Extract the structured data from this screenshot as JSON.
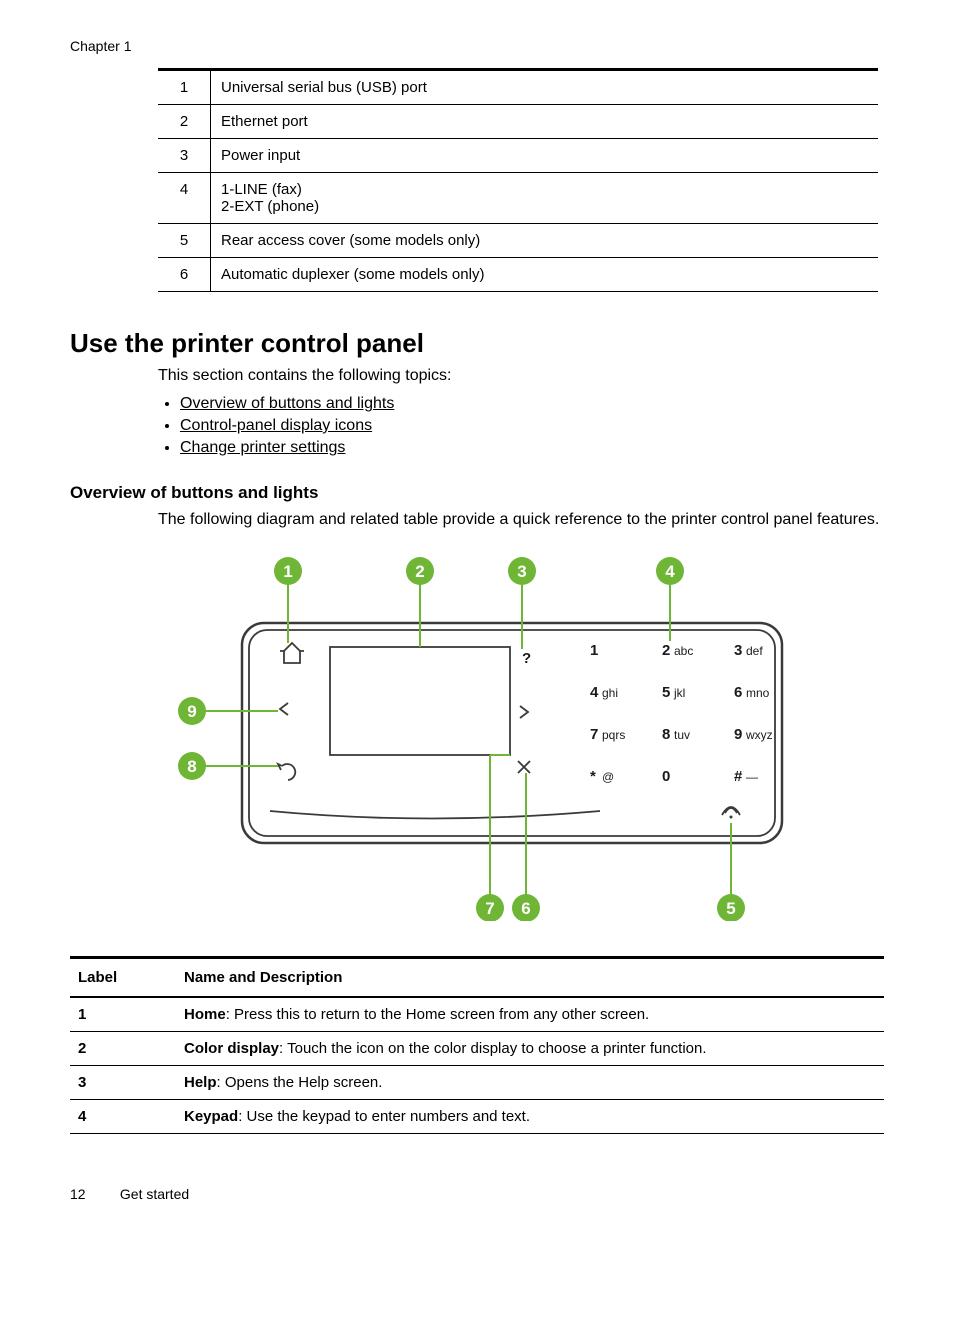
{
  "chapter": "Chapter 1",
  "ports_table": [
    {
      "n": "1",
      "txt": "Universal serial bus (USB) port"
    },
    {
      "n": "2",
      "txt": "Ethernet port"
    },
    {
      "n": "3",
      "txt": "Power input"
    },
    {
      "n": "4",
      "txt": "1-LINE (fax)\n2-EXT (phone)"
    },
    {
      "n": "5",
      "txt": "Rear access cover (some models only)"
    },
    {
      "n": "6",
      "txt": "Automatic duplexer (some models only)"
    }
  ],
  "section_title": "Use the printer control panel",
  "section_intro": "This section contains the following topics:",
  "topics": [
    "Overview of buttons and lights",
    "Control-panel display icons",
    "Change printer settings"
  ],
  "sub_title": "Overview of buttons and lights",
  "sub_desc": "The following diagram and related table provide a quick reference to the printer control panel features.",
  "callouts": [
    "1",
    "2",
    "3",
    "4",
    "5",
    "6",
    "7",
    "8",
    "9"
  ],
  "keypad": {
    "r1": [
      {
        "n": "1",
        "s": ""
      },
      {
        "n": "2",
        "s": "abc"
      },
      {
        "n": "3",
        "s": "def"
      }
    ],
    "r2": [
      {
        "n": "4",
        "s": "ghi"
      },
      {
        "n": "5",
        "s": "jkl"
      },
      {
        "n": "6",
        "s": "mno"
      }
    ],
    "r3": [
      {
        "n": "7",
        "s": "pqrs"
      },
      {
        "n": "8",
        "s": "tuv"
      },
      {
        "n": "9",
        "s": "wxyz"
      }
    ],
    "r4": [
      {
        "n": "*",
        "s": "@"
      },
      {
        "n": "0",
        "s": ""
      },
      {
        "n": "#",
        "s": "—"
      }
    ]
  },
  "labels_header": {
    "col1": "Label",
    "col2": "Name and Description"
  },
  "labels_rows": [
    {
      "n": "1",
      "b": "Home",
      "t": ": Press this to return to the Home screen from any other screen."
    },
    {
      "n": "2",
      "b": "Color display",
      "t": ": Touch the icon on the color display to choose a printer function."
    },
    {
      "n": "3",
      "b": "Help",
      "t": ": Opens the Help screen."
    },
    {
      "n": "4",
      "b": "Keypad",
      "t": ": Use the keypad to enter numbers and text."
    }
  ],
  "footer": {
    "page": "12",
    "title": "Get started"
  }
}
